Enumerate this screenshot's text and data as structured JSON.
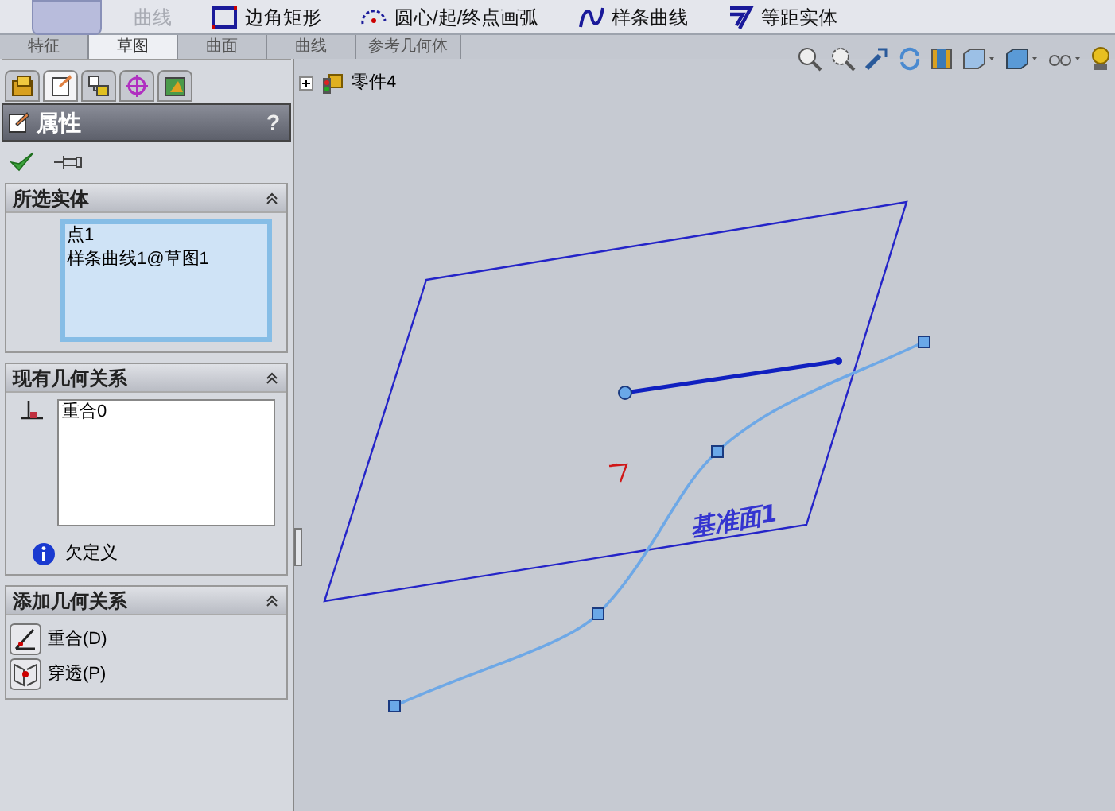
{
  "toolbar": {
    "items": [
      {
        "label": "曲线",
        "disabled": true,
        "kind": "text"
      },
      {
        "label": "边角矩形",
        "disabled": false,
        "kind": "rect"
      },
      {
        "label": "圆心/起/终点画弧",
        "disabled": false,
        "kind": "arc"
      },
      {
        "label": "样条曲线",
        "disabled": false,
        "kind": "spline"
      },
      {
        "label": "等距实体",
        "disabled": false,
        "kind": "offset"
      }
    ]
  },
  "tabs": [
    {
      "label": "特征",
      "selected": false
    },
    {
      "label": "草图",
      "selected": true
    },
    {
      "label": "曲面",
      "selected": false
    },
    {
      "label": "曲线",
      "selected": false
    },
    {
      "label": "参考几何体",
      "selected": false
    }
  ],
  "panel_tabs": [
    {
      "kind": "feature",
      "selected": false
    },
    {
      "kind": "property",
      "selected": true
    },
    {
      "kind": "config",
      "selected": false
    },
    {
      "kind": "target",
      "selected": false
    },
    {
      "kind": "display",
      "selected": false
    }
  ],
  "tree": {
    "label": "零件4",
    "expanded": false
  },
  "property_manager": {
    "title": "属性",
    "help": "?"
  },
  "groups": [
    {
      "kind": "list",
      "title": "所选实体",
      "items": [
        "点1",
        "样条曲线1@草图1"
      ]
    },
    {
      "kind": "relations",
      "title": "现有几何关系",
      "items": [
        "重合0"
      ],
      "status": "欠定义"
    },
    {
      "kind": "buttons",
      "title": "添加几何关系",
      "items": [
        {
          "label": "重合(D)",
          "kind": "coincident"
        },
        {
          "label": "穿透(P)",
          "kind": "pierce"
        }
      ]
    }
  ],
  "canvas": {
    "plane_label": "基准面1"
  }
}
